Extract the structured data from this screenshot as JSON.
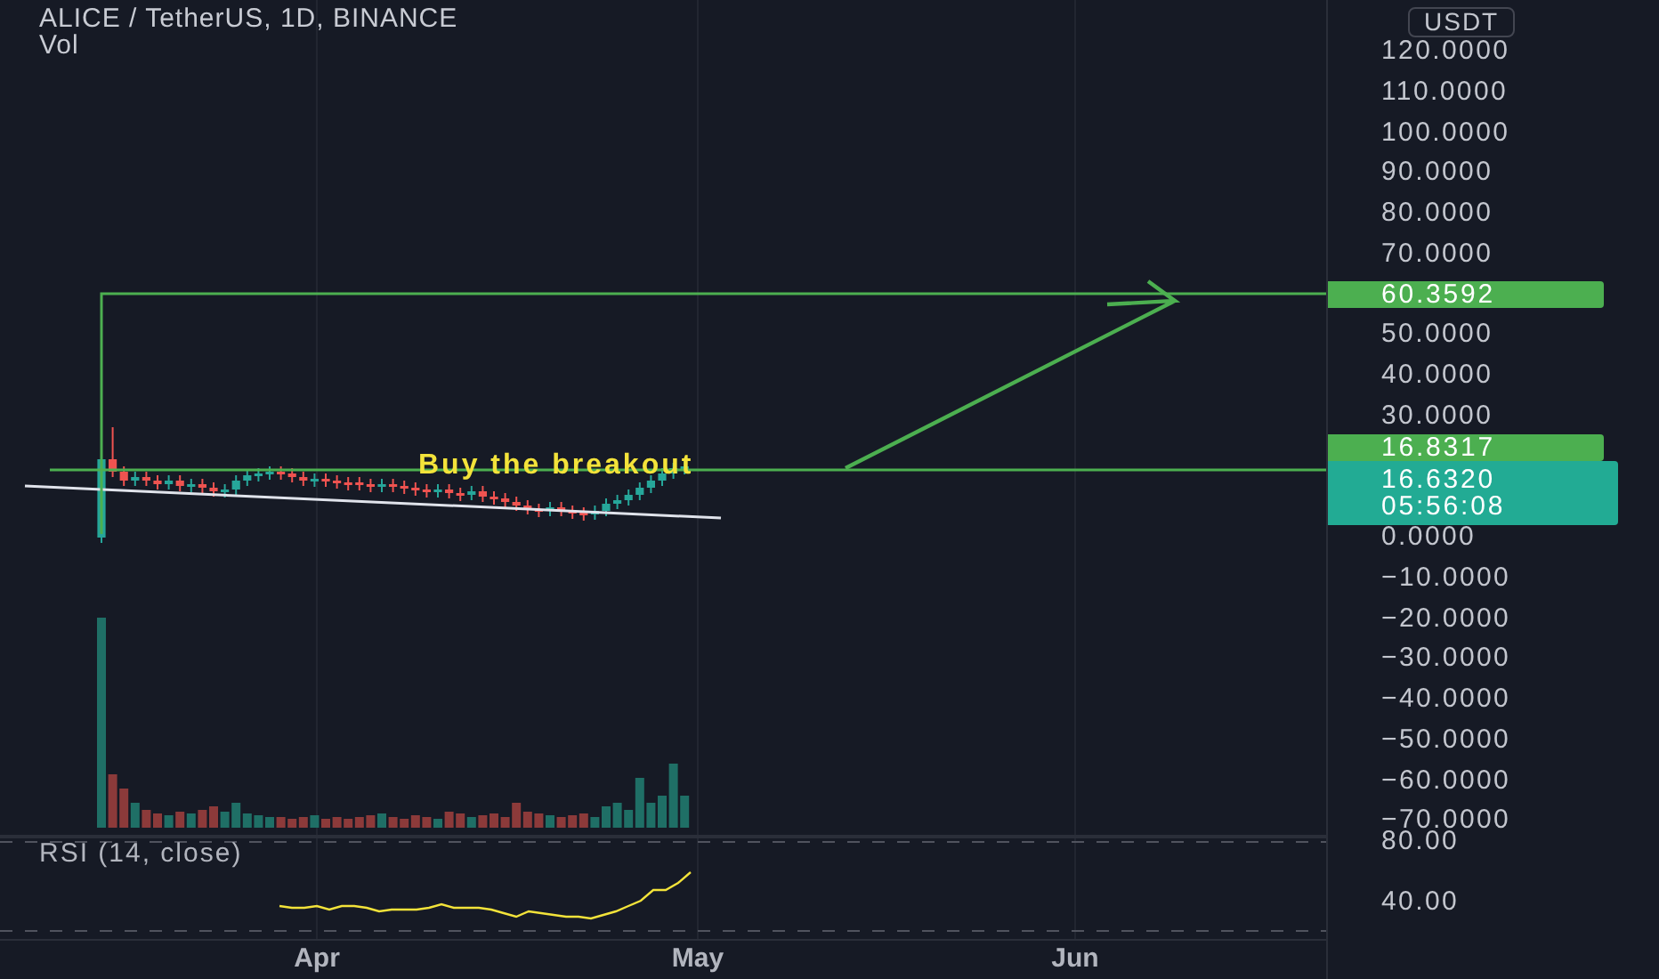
{
  "header": {
    "title": "ALICE / TetherUS, 1D, BINANCE",
    "volume_label": "Vol"
  },
  "currency_button": "USDT",
  "price_axis": {
    "labels": [
      "120.0000",
      "110.0000",
      "100.0000",
      "90.0000",
      "80.0000",
      "70.0000",
      "50.0000",
      "40.0000",
      "30.0000",
      "0.0000",
      "−10.0000",
      "−20.0000",
      "−30.0000",
      "−40.0000",
      "−50.0000",
      "−60.0000",
      "−70.0000"
    ]
  },
  "price_tags": [
    {
      "kind": "target",
      "text": "60.3592"
    },
    {
      "kind": "breakout",
      "text": "16.8317"
    },
    {
      "kind": "last",
      "text": "16.6320",
      "countdown": "05:56:08"
    }
  ],
  "annotation": "Buy the breakout",
  "rsi": {
    "label": "RSI (14, close)",
    "labels": [
      "80.00",
      "40.00"
    ]
  },
  "time_axis": [
    "Apr",
    "May",
    "Jun"
  ]
}
